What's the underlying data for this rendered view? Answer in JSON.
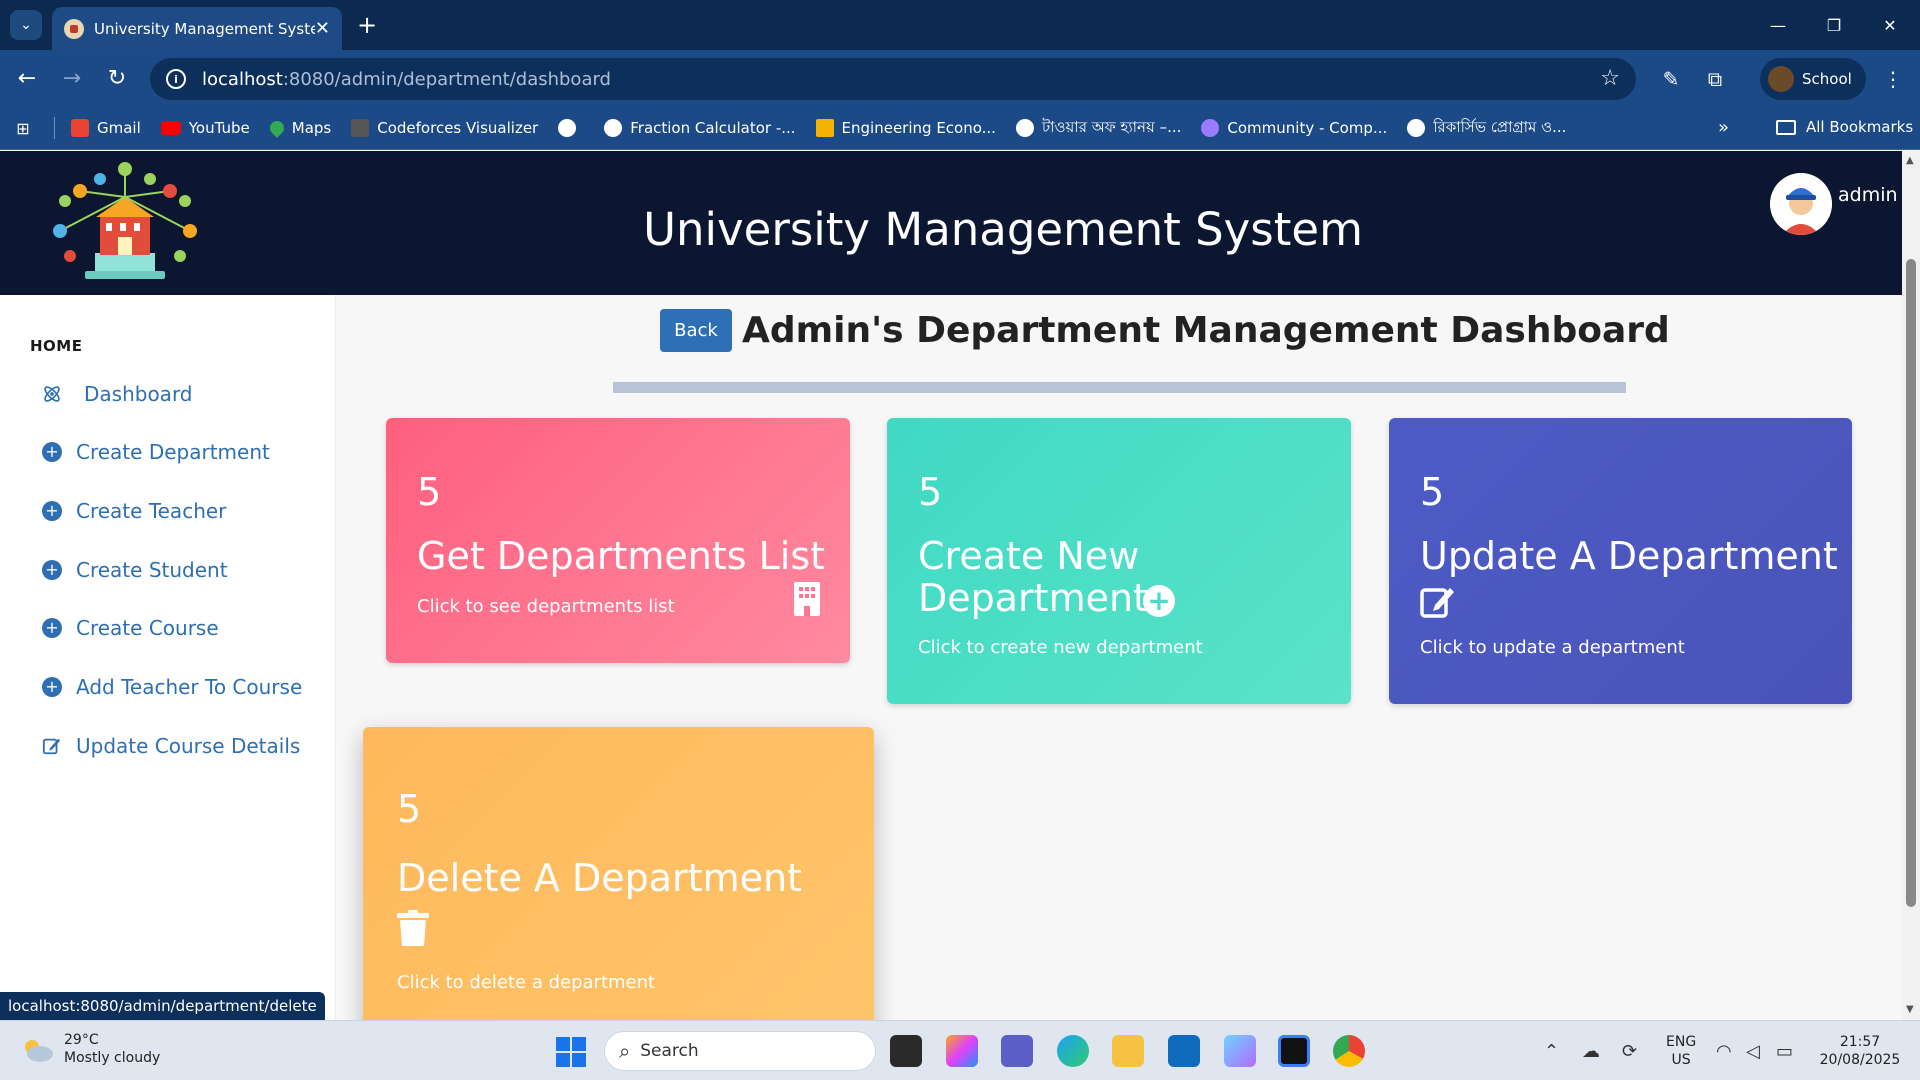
{
  "browser": {
    "tab_title": "University Management System",
    "url_host": "localhost",
    "url_path": ":8080/admin/department/dashboard",
    "profile_name": "School",
    "bookmarks": [
      {
        "label": "Gmail",
        "color": "#ea4335"
      },
      {
        "label": "YouTube",
        "color": "#ff0000"
      },
      {
        "label": "Maps",
        "color": "#34a853"
      },
      {
        "label": "Codeforces Visualizer",
        "color": "#555555"
      },
      {
        "label": "",
        "color": "#ffffff"
      },
      {
        "label": "Fraction Calculator -...",
        "color": "#ffffff"
      },
      {
        "label": "Engineering Econo...",
        "color": "#f4b400"
      },
      {
        "label": "টাওয়ার অফ হ্যানয় –...",
        "color": "#ffffff"
      },
      {
        "label": "Community - Comp...",
        "color": "#9b7bff"
      },
      {
        "label": "রিকার্সিভ প্রোগ্রাম ও...",
        "color": "#ffffff"
      }
    ],
    "all_bookmarks": "All Bookmarks",
    "status_url": "localhost:8080/admin/department/delete"
  },
  "header": {
    "app_title": "University Management System",
    "user_name": "admin"
  },
  "sidebar": {
    "home_label": "HOME",
    "items": [
      {
        "label": "Dashboard",
        "icon": "atom-icon"
      },
      {
        "label": "Create Department",
        "icon": "plus-circle-icon"
      },
      {
        "label": "Create Teacher",
        "icon": "plus-circle-icon"
      },
      {
        "label": "Create Student",
        "icon": "plus-circle-icon"
      },
      {
        "label": "Create Course",
        "icon": "plus-circle-icon"
      },
      {
        "label": "Add Teacher To Course",
        "icon": "plus-circle-icon"
      },
      {
        "label": "Update Course Details",
        "icon": "edit-icon"
      }
    ]
  },
  "main": {
    "back_label": "Back",
    "title": "Admin's Department Management Dashboard",
    "cards": [
      {
        "count": "5",
        "title": "Get Departments List",
        "subtitle": "Click to see departments list",
        "icon": "building-icon",
        "colors": [
          "#ff5f7e",
          "#ff8aa0"
        ]
      },
      {
        "count": "5",
        "title_line1": "Create New",
        "title_line2": "Department",
        "subtitle": "Click to create new department",
        "icon": "plus-circle-icon",
        "colors": [
          "#3fd9c4",
          "#5ae3c8"
        ]
      },
      {
        "count": "5",
        "title": "Update A Department",
        "subtitle": "Click to update a department",
        "icon": "edit-icon",
        "colors": [
          "#4e5bc7",
          "#4a54b8"
        ]
      },
      {
        "count": "5",
        "title": "Delete A Department",
        "subtitle": "Click to delete a department",
        "icon": "trash-icon",
        "colors": [
          "#ffb85c",
          "#ffc56b"
        ]
      }
    ]
  },
  "taskbar": {
    "temperature": "29°C",
    "weather": "Mostly cloudy",
    "search_placeholder": "Search",
    "lang_line1": "ENG",
    "lang_line2": "US",
    "time": "21:57",
    "date": "20/08/2025"
  }
}
